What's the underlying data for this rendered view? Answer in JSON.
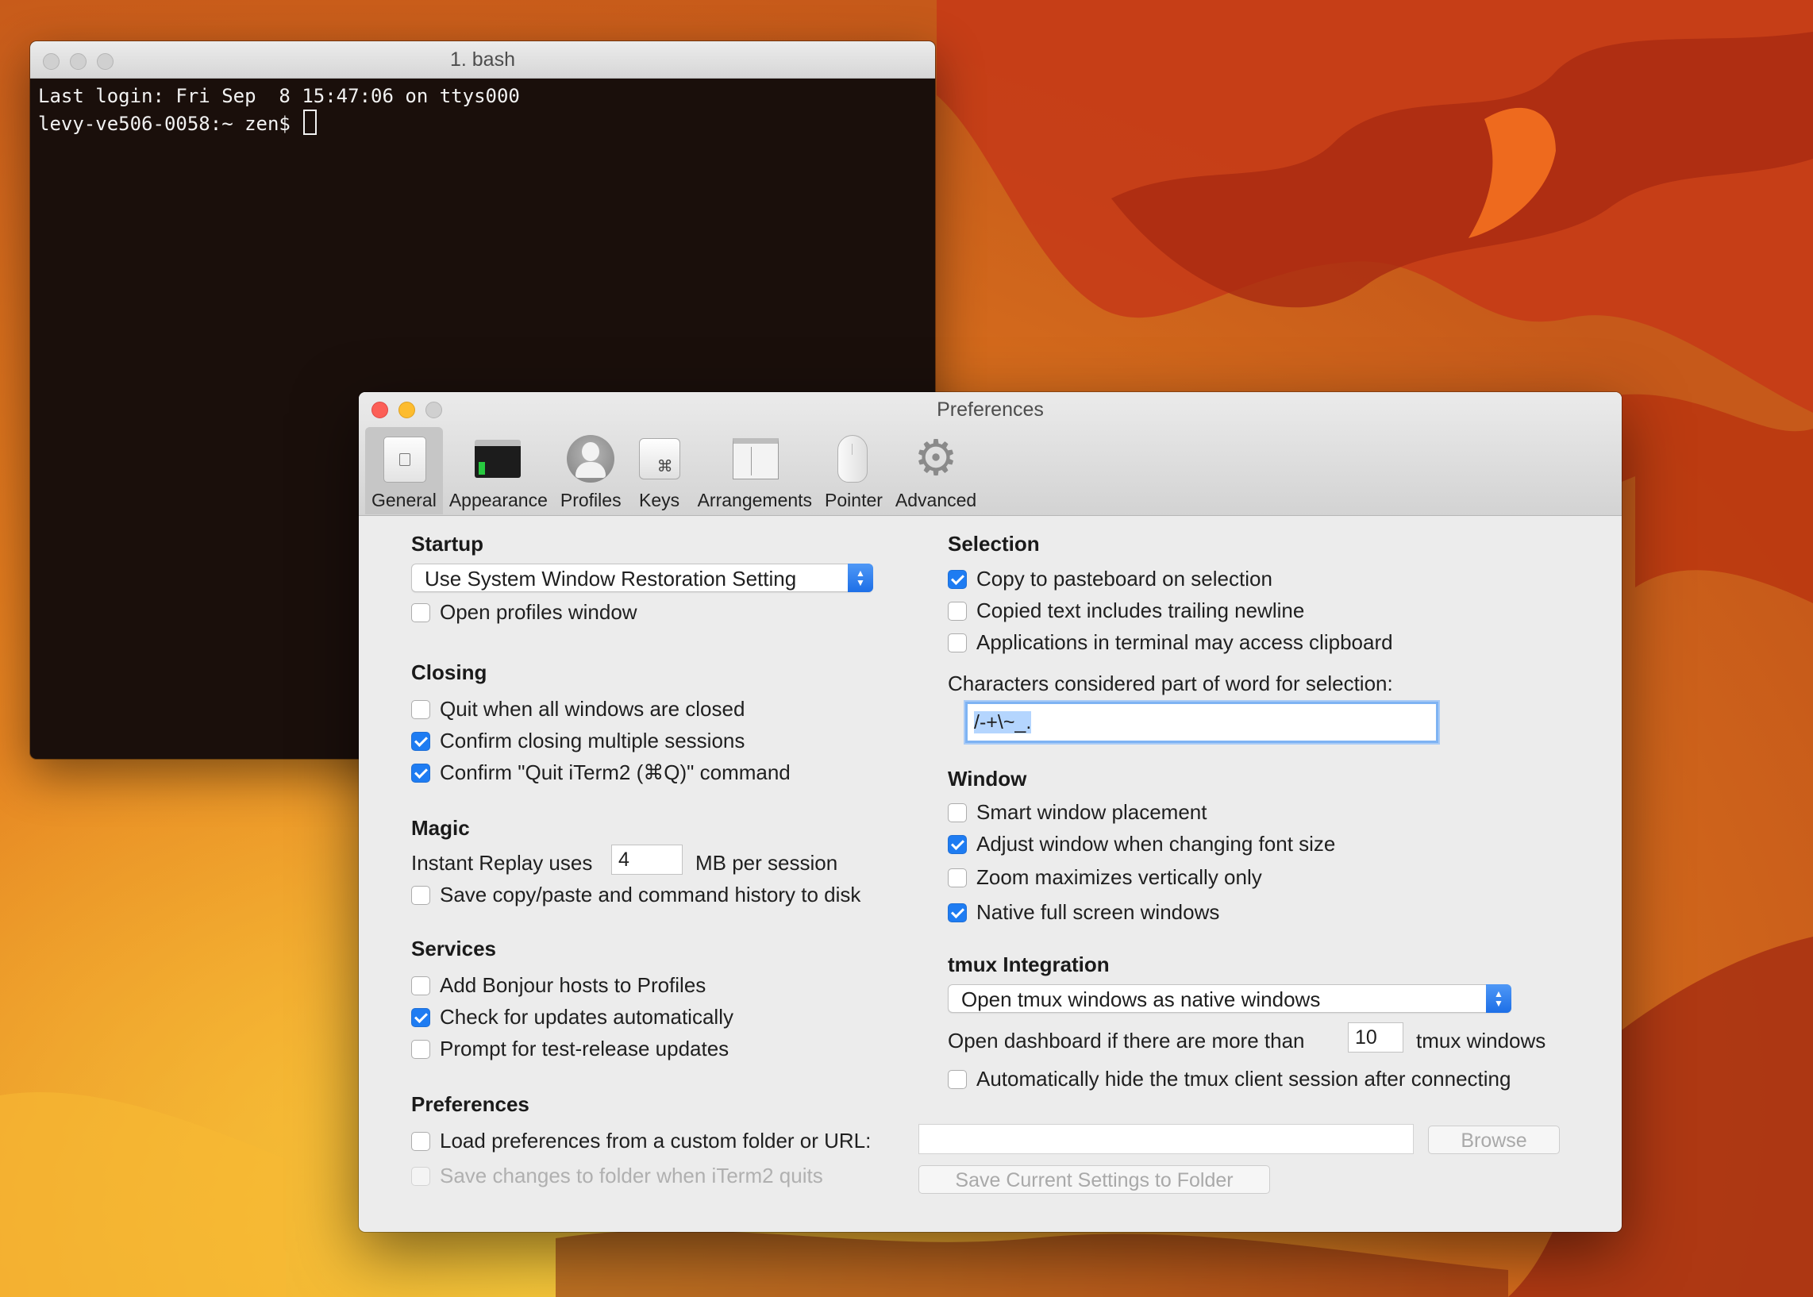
{
  "terminal": {
    "title": "1. bash",
    "lines": [
      "Last login: Fri Sep  8 15:47:06 on ttys000",
      "levy-ve506-0058:~ zen$ "
    ]
  },
  "prefs": {
    "title": "Preferences",
    "tabs": [
      {
        "label": "General",
        "icon": "general-switch-icon",
        "active": true
      },
      {
        "label": "Appearance",
        "icon": "appearance-window-icon"
      },
      {
        "label": "Profiles",
        "icon": "profile-user-icon"
      },
      {
        "label": "Keys",
        "icon": "keys-command-icon"
      },
      {
        "label": "Arrangements",
        "icon": "arrangements-windows-icon"
      },
      {
        "label": "Pointer",
        "icon": "pointer-mouse-icon"
      },
      {
        "label": "Advanced",
        "icon": "advanced-gear-icon"
      }
    ],
    "startup": {
      "heading": "Startup",
      "popup": "Use System Window Restoration Setting",
      "open_profiles": {
        "label": "Open profiles window",
        "checked": false
      }
    },
    "closing": {
      "heading": "Closing",
      "items": [
        {
          "label": "Quit when all windows are closed",
          "checked": false
        },
        {
          "label": "Confirm closing multiple sessions",
          "checked": true
        },
        {
          "label": "Confirm \"Quit iTerm2 (⌘Q)\" command",
          "checked": true
        }
      ]
    },
    "magic": {
      "heading": "Magic",
      "replay_prefix": "Instant Replay uses",
      "replay_value": "4",
      "replay_suffix": "MB per session",
      "save_history": {
        "label": "Save copy/paste and command history to disk",
        "checked": false
      }
    },
    "services": {
      "heading": "Services",
      "items": [
        {
          "label": "Add Bonjour hosts to Profiles",
          "checked": false
        },
        {
          "label": "Check for updates automatically",
          "checked": true
        },
        {
          "label": "Prompt for test-release updates",
          "checked": false
        }
      ]
    },
    "preferences": {
      "heading": "Preferences",
      "load_custom": {
        "label": "Load preferences from a custom folder or URL:",
        "checked": false
      },
      "save_changes": {
        "label": "Save changes to folder when iTerm2 quits",
        "checked": false
      },
      "folder_value": "",
      "browse": "Browse",
      "save_current": "Save Current Settings to Folder"
    },
    "selection": {
      "heading": "Selection",
      "items": [
        {
          "label": "Copy to pasteboard on selection",
          "checked": true
        },
        {
          "label": "Copied text includes trailing newline",
          "checked": false
        },
        {
          "label": "Applications in terminal may access clipboard",
          "checked": false
        }
      ],
      "word_chars_label": "Characters considered part of word for selection:",
      "word_chars_value": "/-+\\~_."
    },
    "window": {
      "heading": "Window",
      "items": [
        {
          "label": "Smart window placement",
          "checked": false
        },
        {
          "label": "Adjust window when changing font size",
          "checked": true
        },
        {
          "label": "Zoom maximizes vertically only",
          "checked": false
        },
        {
          "label": "Native full screen windows",
          "checked": true
        }
      ]
    },
    "tmux": {
      "heading": "tmux Integration",
      "popup": "Open tmux windows as native windows",
      "dashboard_prefix": "Open dashboard if there are more than",
      "dashboard_value": "10",
      "dashboard_suffix": "tmux windows",
      "auto_hide": {
        "label": "Automatically hide the tmux client session after connecting",
        "checked": false
      }
    }
  }
}
